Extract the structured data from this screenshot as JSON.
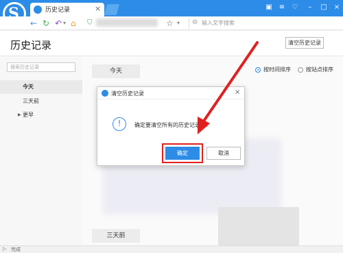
{
  "browser": {
    "tab_title": "历史记录",
    "tab_close": "×",
    "search_placeholder": "输入文字搜索",
    "window_buttons": [
      "▣",
      "≡",
      "♡",
      "–",
      "□",
      "×"
    ]
  },
  "page": {
    "title": "历史记录",
    "clear_button": "清空历史记录",
    "sidebar_search_placeholder": "搜索历史记录",
    "sidebar_items": [
      "今天",
      "三天前",
      "更早"
    ],
    "sections": [
      "今天",
      "三天前"
    ],
    "sort_options": [
      "按时间排序",
      "按站点排序"
    ],
    "sort_selected": "按时间排序"
  },
  "dialog": {
    "title": "清空历史记录",
    "close": "×",
    "message": "确定要清空所有的历史记录吗？",
    "ok_label": "确定",
    "cancel_label": "取消",
    "info_icon": "!"
  },
  "status": {
    "text": "完成"
  },
  "colors": {
    "accent": "#2d8ce8",
    "highlight": "#e02020"
  }
}
